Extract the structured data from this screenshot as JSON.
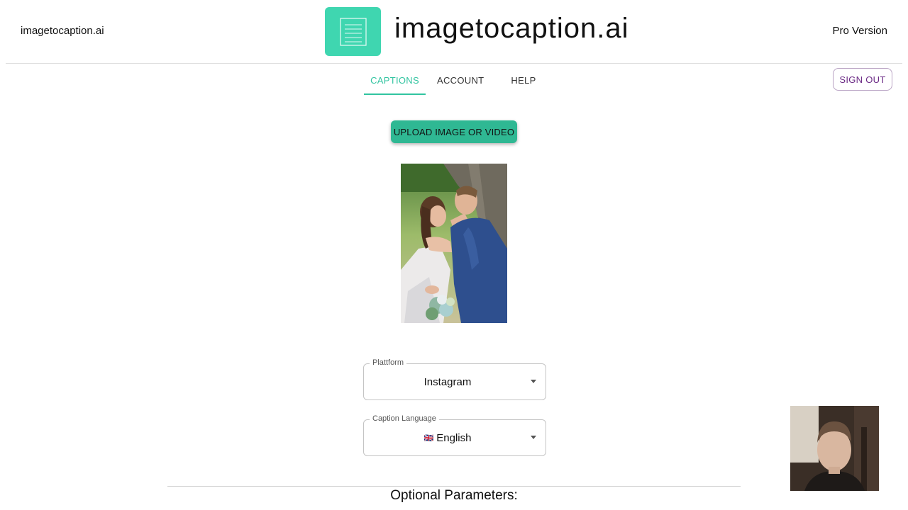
{
  "header": {
    "left_text": "imagetocaption.ai",
    "title": "imagetocaption.ai",
    "right_text": "Pro Version",
    "logo_icon": "document-icon",
    "accent_color": "#3fd6b0"
  },
  "tabs": [
    {
      "label": "CAPTIONS",
      "active": true
    },
    {
      "label": "ACCOUNT",
      "active": false
    },
    {
      "label": "HELP",
      "active": false
    }
  ],
  "signout_label": "SIGN OUT",
  "upload_label": "UPLOAD IMAGE OR VIDEO",
  "platform": {
    "label": "Plattform",
    "value": "Instagram"
  },
  "language": {
    "label": "Caption Language",
    "flag": "🇬🇧",
    "value": "English"
  },
  "optional_title": "Optional Parameters:"
}
